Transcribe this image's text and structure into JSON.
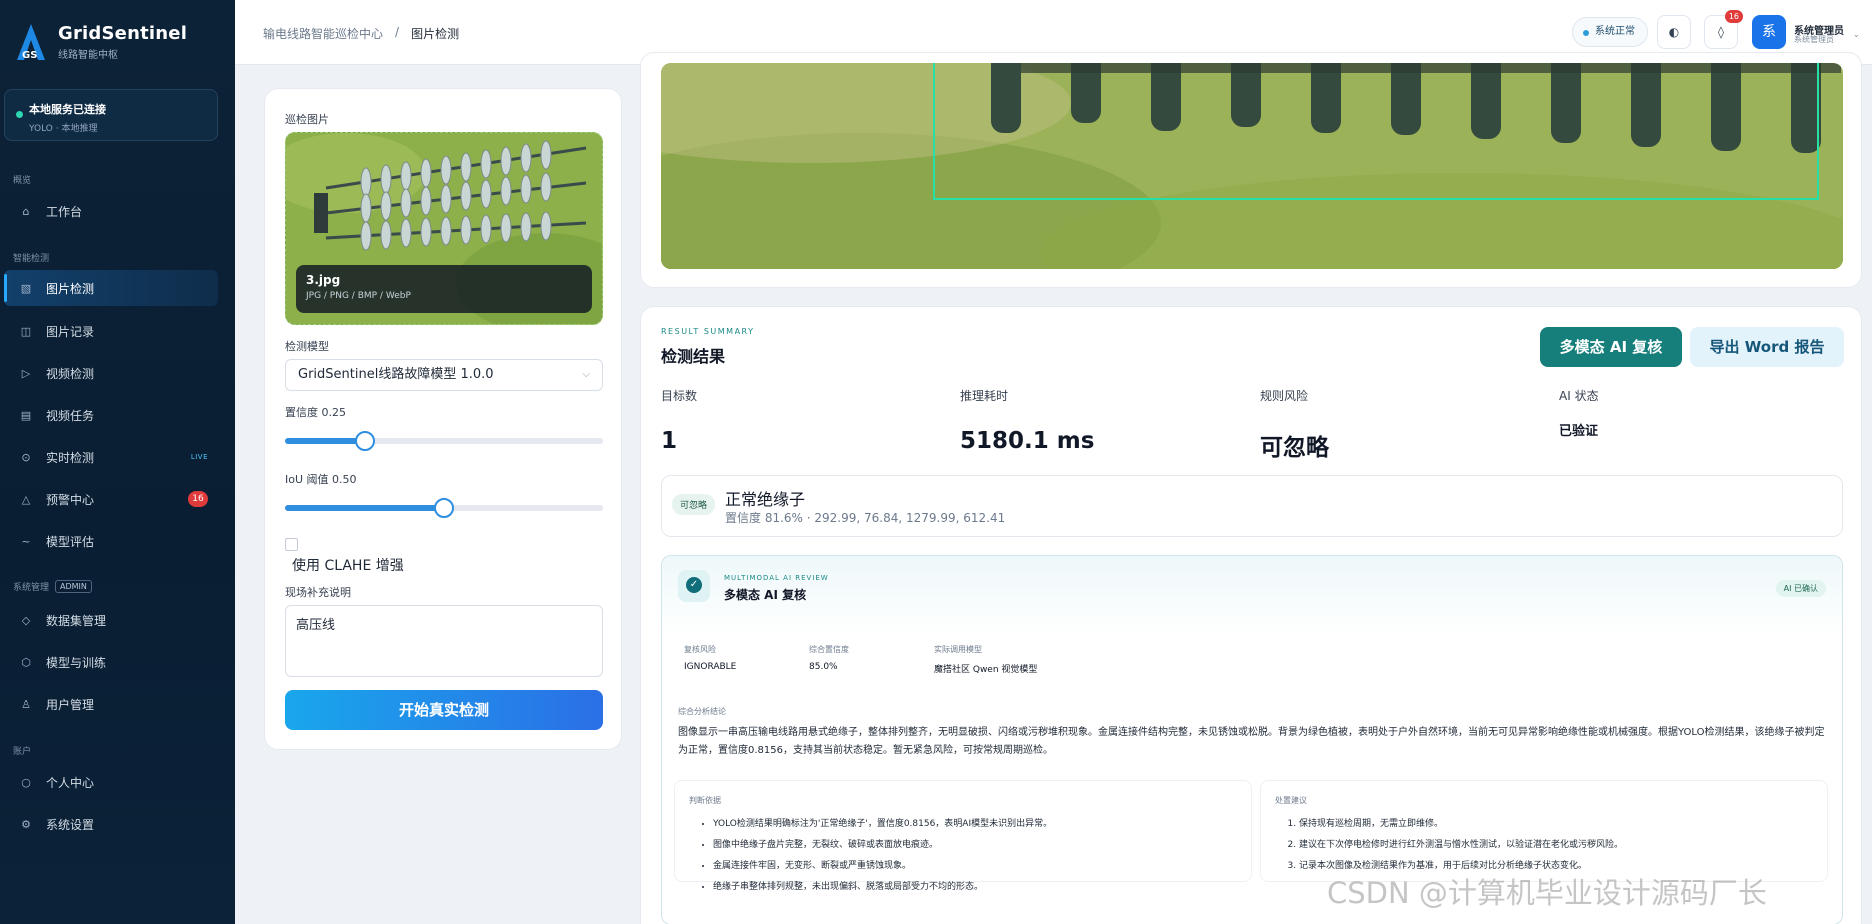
{
  "brand": {
    "logo_text": "GS",
    "title": "GridSentinel",
    "subtitle": "线路智能中枢"
  },
  "service": {
    "title": "本地服务已连接",
    "subtitle": "YOLO · 本地推理"
  },
  "nav": {
    "section_overview": "概览",
    "workbench": "工作台",
    "section_detect": "智能检测",
    "image_detect": "图片检测",
    "image_records": "图片记录",
    "video_detect": "视频检测",
    "video_tasks": "视频任务",
    "realtime_detect": "实时检测",
    "live_tag": "LIVE",
    "alert_center": "预警中心",
    "alert_count": "16",
    "model_eval": "模型评估",
    "section_system": "系统管理",
    "admin_tag": "ADMIN",
    "dataset_mgmt": "数据集管理",
    "model_training": "模型与训练",
    "user_mgmt": "用户管理",
    "section_account": "账户",
    "profile": "个人中心",
    "settings": "系统设置"
  },
  "topbar": {
    "crumb_root": "输电线路智能巡检中心",
    "crumb_sep": "/",
    "crumb_current": "图片检测",
    "status": "系统正常",
    "theme_icon": "◐",
    "bell_icon": "◊",
    "bell_count": "16",
    "avatar_char": "系",
    "user_name": "系统管理员",
    "user_role": "系统管理员",
    "chevron": "⌄"
  },
  "left": {
    "image_label": "巡检图片",
    "file_name": "3.jpg",
    "file_types": "JPG / PNG / BMP / WebP",
    "model_label": "检测模型",
    "model_value": "GridSentinel线路故障模型 1.0.0",
    "conf_label": "置信度 0.25",
    "conf_value": 0.25,
    "iou_label": "IoU 阈值 0.50",
    "iou_value": 0.5,
    "clahe_label": "使用 CLAHE 增强",
    "note_label": "现场补充说明",
    "note_value": "高压线",
    "start_button": "开始真实检测"
  },
  "result": {
    "eyebrow": "RESULT SUMMARY",
    "title": "检测结果",
    "ai_button": "多模态 AI 复核",
    "word_button": "导出 Word 报告",
    "stats": [
      {
        "label": "目标数",
        "value": "1"
      },
      {
        "label": "推理耗时",
        "value": "5180.1 ms"
      },
      {
        "label": "规则风险",
        "value": "可忽略"
      },
      {
        "label": "AI 状态",
        "value": "已验证"
      }
    ],
    "detection": {
      "tag": "可忽略",
      "name": "正常绝缘子",
      "detail": "置信度 81.6% · 292.99, 76.84, 1279.99, 612.41"
    }
  },
  "ai_review": {
    "eyebrow": "MULTIMODAL AI REVIEW",
    "title": "多模态 AI 复核",
    "badge": "AI 已确认",
    "fields": [
      {
        "label": "复核风险",
        "value": "IGNORABLE"
      },
      {
        "label": "综合置信度",
        "value": "85.0%"
      },
      {
        "label": "实际调用模型",
        "value": "魔搭社区 Qwen 视觉模型"
      }
    ],
    "summary_label": "综合分析结论",
    "summary": "图像显示一串高压输电线路用悬式绝缘子，整体排列整齐，无明显破损、闪络或污秽堆积现象。金属连接件结构完整，未见锈蚀或松脱。背景为绿色植被，表明处于户外自然环境，当前无可见异常影响绝缘性能或机械强度。根据YOLO检测结果，该绝缘子被判定为正常，置信度0.8156，支持其当前状态稳定。暂无紧急风险，可按常规周期巡检。",
    "evidence_label": "判断依据",
    "evidence": [
      "YOLO检测结果明确标注为'正常绝缘子'，置信度0.8156，表明AI模型未识别出异常。",
      "图像中绝缘子盘片完整，无裂纹、破碎或表面放电痕迹。",
      "金属连接件牢固，无变形、断裂或严重锈蚀现象。",
      "绝缘子串整体排列规整，未出现偏斜、脱落或局部受力不均的形态。"
    ],
    "advice_label": "处置建议",
    "advice": [
      "保持现有巡检周期，无需立即维修。",
      "建议在下次停电检修时进行红外测温与憎水性测试，以验证潜在老化或污秽风险。",
      "记录本次图像及检测结果作为基准，用于后续对比分析绝缘子状态变化。"
    ]
  },
  "watermark": "CSDN @计算机毕业设计源码厂长"
}
